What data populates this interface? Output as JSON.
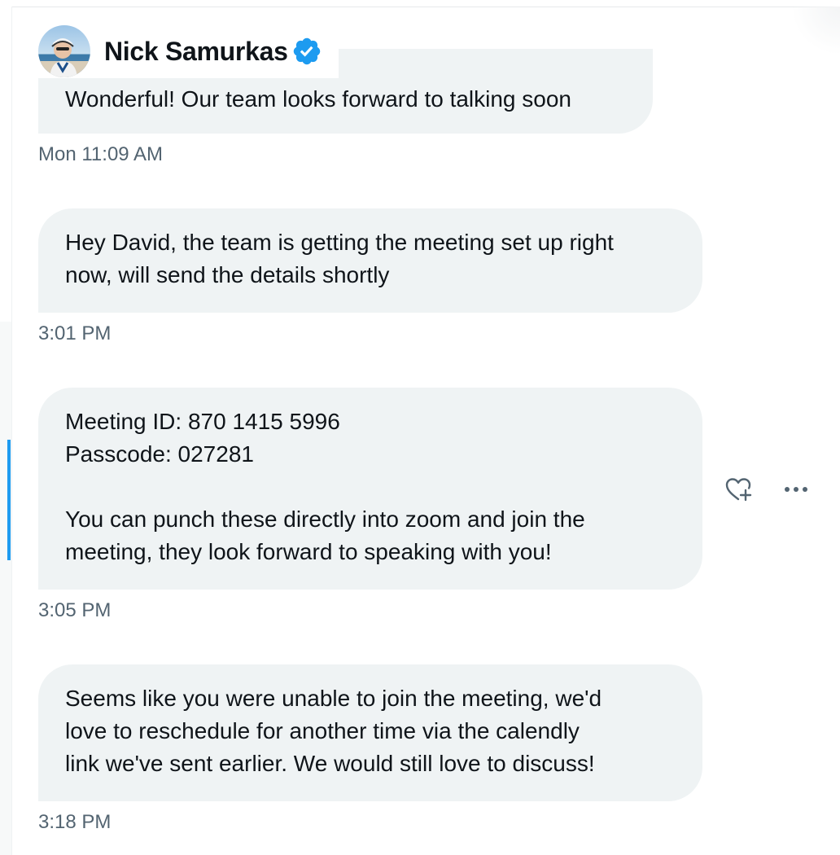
{
  "conversation": {
    "user_name": "Nick Samurkas",
    "verified": true,
    "accent_color": "#1d9bf0"
  },
  "messages": [
    {
      "lines": [
        "Wonderful! Our team looks forward to talking soon"
      ],
      "timestamp": "Mon 11:09 AM"
    },
    {
      "lines": [
        "Hey David, the team is getting the meeting set up right",
        "now, will send the details shortly"
      ],
      "timestamp": "3:01 PM"
    },
    {
      "lines": [
        "Meeting ID: 870 1415 5996",
        "Passcode: 027281",
        "",
        "You can punch these directly into zoom and join the",
        "meeting, they look forward to speaking with you!"
      ],
      "timestamp": "3:05 PM"
    },
    {
      "lines": [
        "Seems like you were unable to join the meeting, we'd",
        "love to reschedule for another time via the calendly",
        "link we've sent earlier. We would still love to discuss!"
      ],
      "timestamp": "3:18 PM"
    }
  ],
  "message_actions": {
    "like_icon": "heart-plus-icon",
    "more_icon": "more-horizontal-icon"
  }
}
